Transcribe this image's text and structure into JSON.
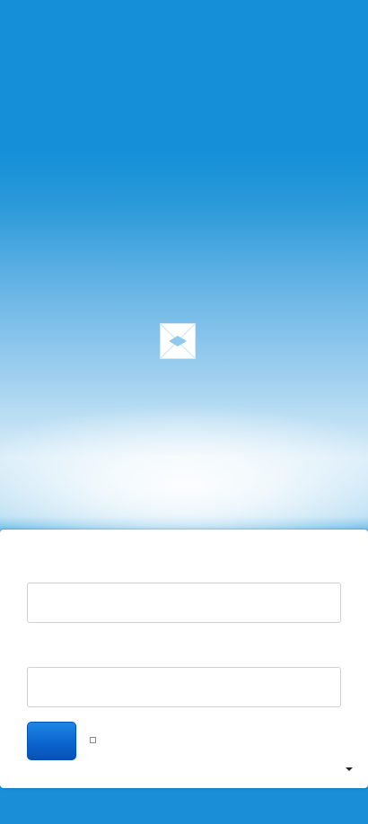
{
  "logo": {
    "icon": "broken-image-icon"
  },
  "login_form": {
    "username_label": "",
    "username_placeholder": "",
    "password_label": "",
    "password_placeholder": "",
    "submit_label": "",
    "remember_label": "",
    "menu_icon": "caret-down-icon"
  },
  "colors": {
    "background_top": "#1590d8",
    "background_glow": "#d7ecf8",
    "background_bottom": "#1a8fd8",
    "panel": "#ffffff",
    "button": "#0a63cc"
  }
}
